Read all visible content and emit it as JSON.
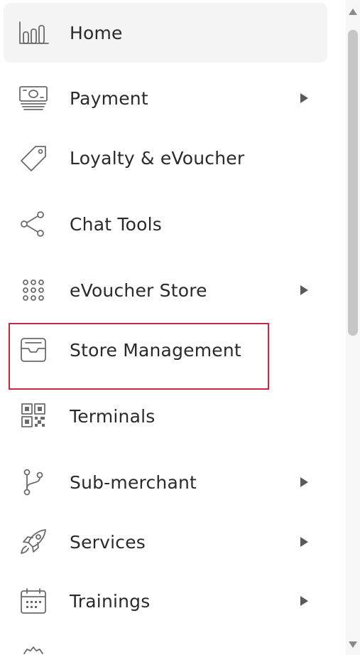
{
  "menu": {
    "items": [
      {
        "label": "Home",
        "icon": "bar-chart-icon",
        "has_submenu": false,
        "active": true
      },
      {
        "label": "Payment",
        "icon": "cash-register-icon",
        "has_submenu": true
      },
      {
        "label": "Loyalty & eVoucher",
        "icon": "tag-icon",
        "has_submenu": false
      },
      {
        "label": "Chat Tools",
        "icon": "share-icon",
        "has_submenu": false
      },
      {
        "label": "eVoucher Store",
        "icon": "grid-dots-icon",
        "has_submenu": true
      },
      {
        "label": "Store Management",
        "icon": "inbox-tray-icon",
        "has_submenu": false,
        "highlighted": true
      },
      {
        "label": "Terminals",
        "icon": "qr-code-icon",
        "has_submenu": false
      },
      {
        "label": "Sub-merchant",
        "icon": "branch-icon",
        "has_submenu": true
      },
      {
        "label": "Services",
        "icon": "rocket-icon",
        "has_submenu": true
      },
      {
        "label": "Trainings",
        "icon": "calendar-icon",
        "has_submenu": true
      }
    ]
  },
  "colors": {
    "highlight_border": "#c8293b",
    "active_background": "#f4f4f5",
    "icon": "#6b6b6b",
    "text": "#2a2a2a"
  }
}
